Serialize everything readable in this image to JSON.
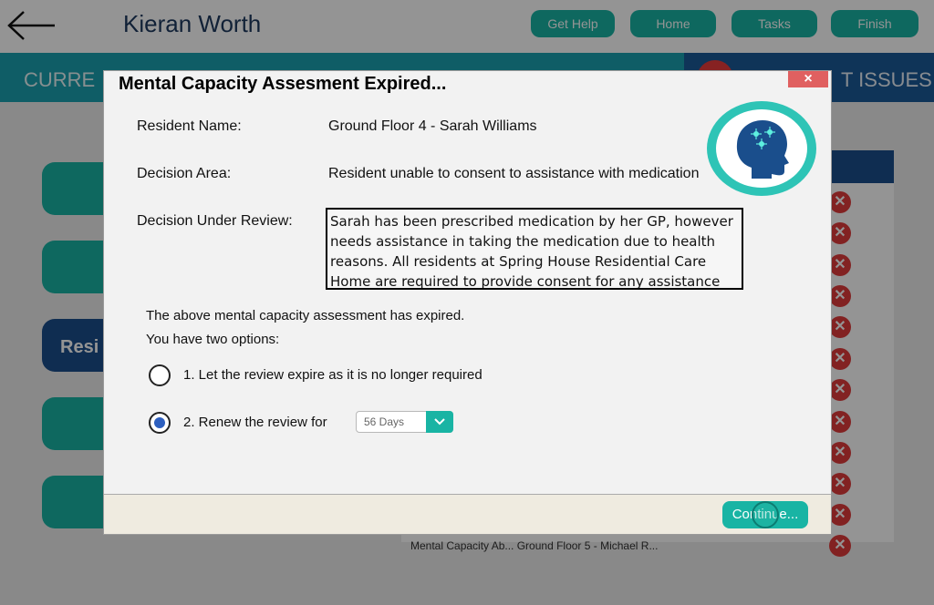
{
  "app": {
    "user_name": "Kieran Worth",
    "nav": [
      "Get Help",
      "Home",
      "Tasks",
      "Finish"
    ],
    "band_left": "CURRE",
    "band_right": "T ISSUES",
    "side_active_label": "Resi",
    "list_bottom_text": "Mental Capacity Ab...            Ground Floor 5 - Michael R..."
  },
  "dialog": {
    "title": "Mental Capacity Assesment Expired...",
    "close_label": "×",
    "resident_label": "Resident Name:",
    "resident_value": "Ground Floor 4 - Sarah Williams",
    "decision_area_label": "Decision Area:",
    "decision_area_value": "Resident unable to consent to assistance with medication",
    "decision_review_label": "Decision Under Review:",
    "decision_review_text": "Sarah has been prescribed medication by her GP, however needs assistance in taking the medication due to health reasons. All residents at Spring House Residential Care Home are required to provide consent for any assistance they receive",
    "expired_text": "The above mental capacity assessment has expired.",
    "options_text": "You have two options:",
    "option1": "1. Let the review expire as it is no longer required",
    "option2": "2. Renew the review for",
    "renew_select": "56 Days",
    "continue_label": "Continue...",
    "selected_option": 2
  },
  "colors": {
    "teal": "#19b4a4",
    "navy": "#1a4e8c",
    "alert_red": "#e03c3c"
  }
}
